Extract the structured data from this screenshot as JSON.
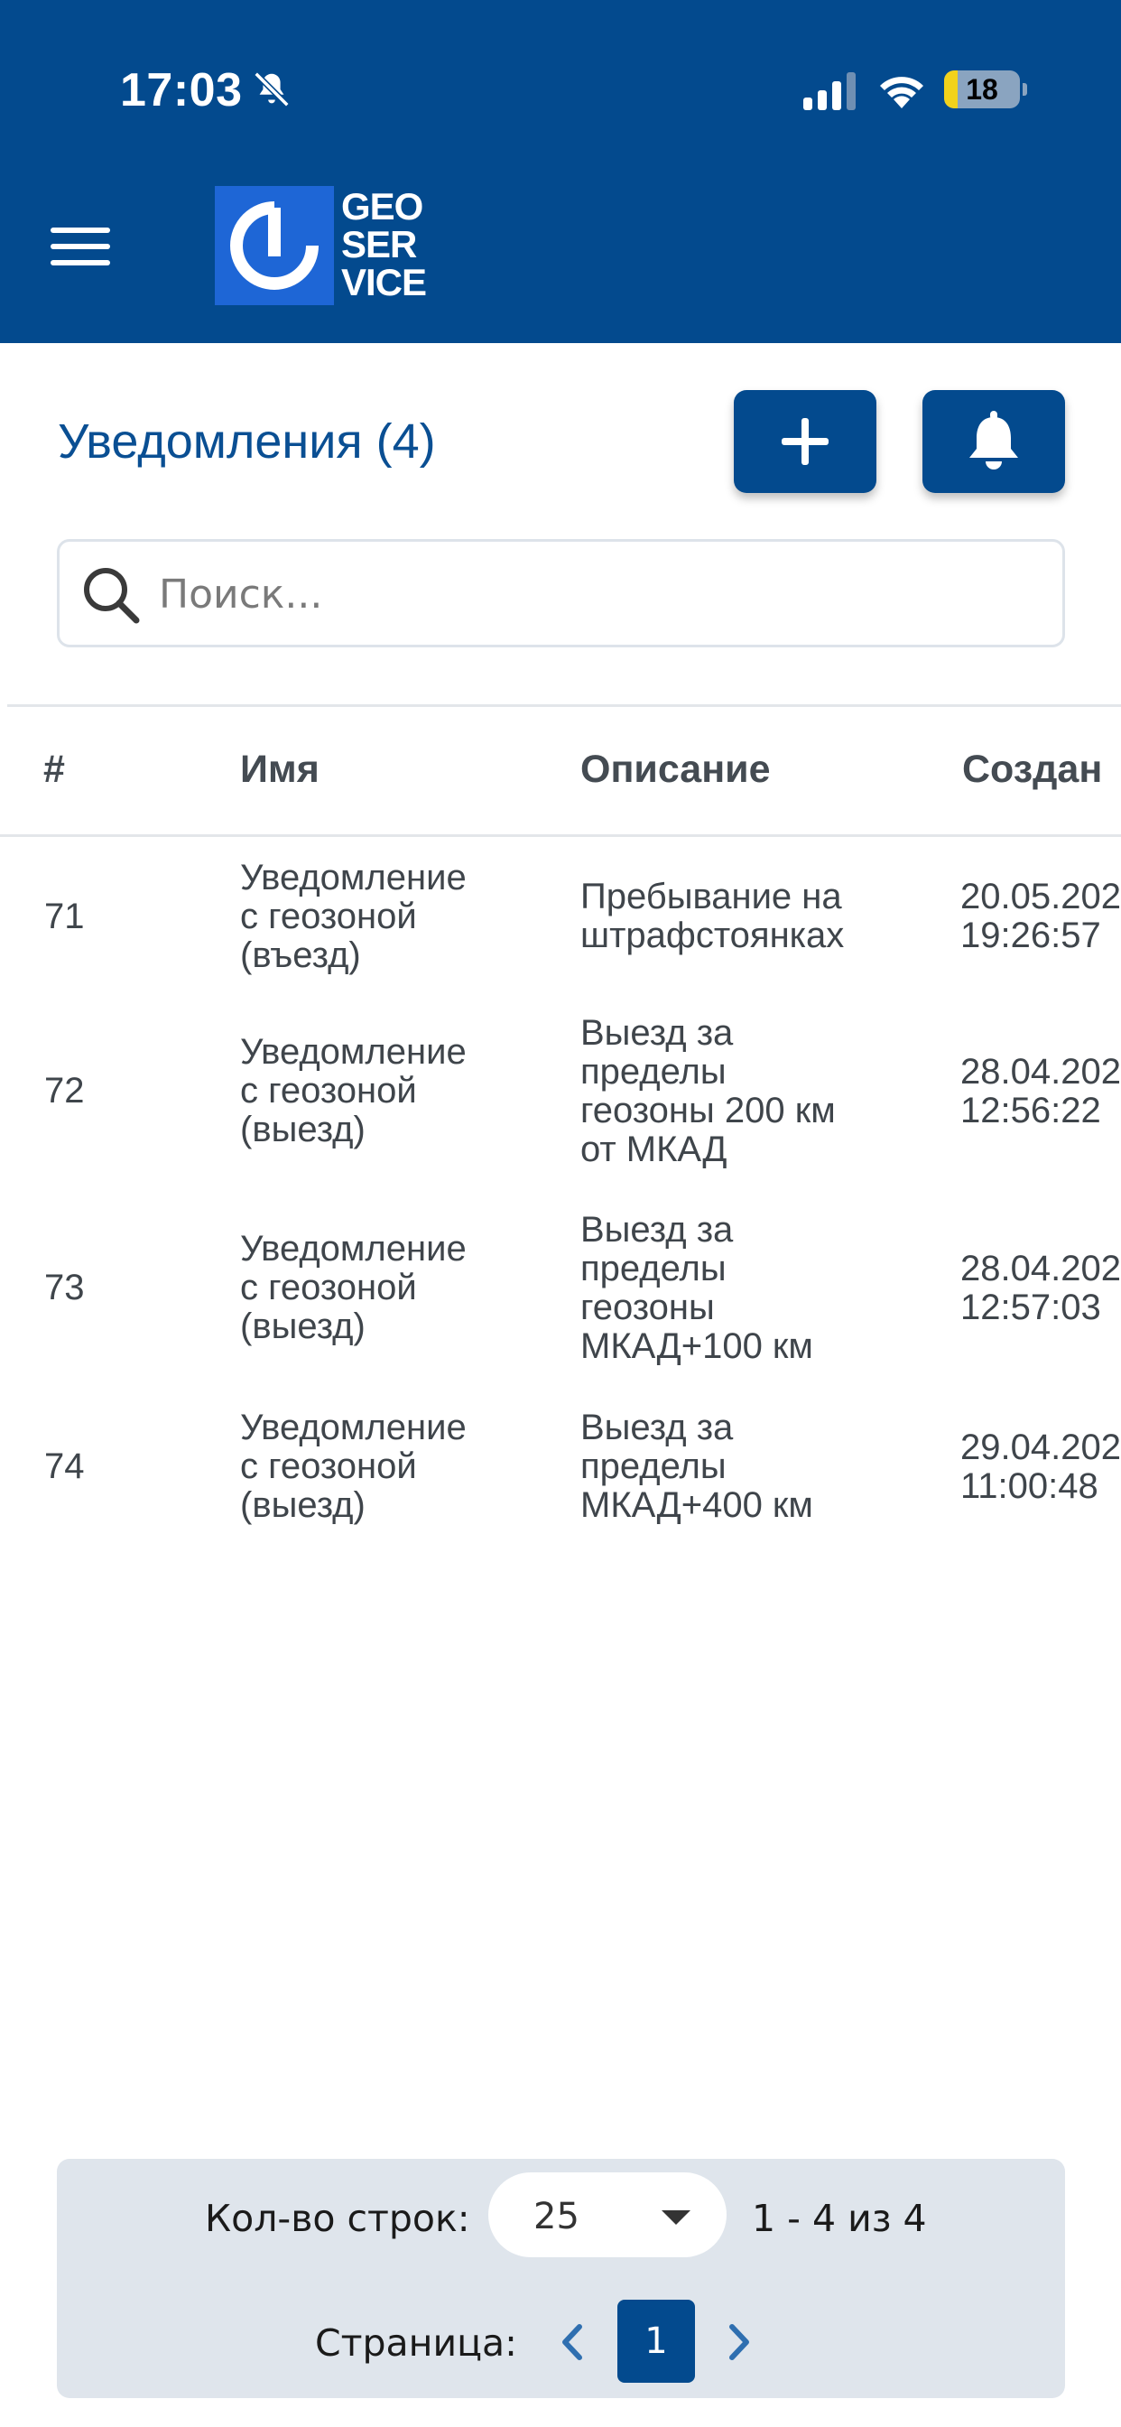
{
  "status_bar": {
    "time": "17:03",
    "battery": "18",
    "battery_level": 0.18
  },
  "app": {
    "logo_text_line1": "GEO",
    "logo_text_line2": "SER",
    "logo_text_line3": "VICE"
  },
  "header": {
    "title": "Уведомления (4)"
  },
  "search": {
    "placeholder": "Поиск..."
  },
  "table": {
    "columns": [
      "#",
      "Имя",
      "Описание",
      "Создан"
    ],
    "rows": [
      {
        "id": "71",
        "name": [
          "Уведомление",
          "с геозоной",
          "(въезд)"
        ],
        "description": [
          "Пребывание на",
          "штрафстоянках"
        ],
        "created": [
          "20.05.202",
          "19:26:57"
        ]
      },
      {
        "id": "72",
        "name": [
          "Уведомление",
          "с геозоной",
          "(выезд)"
        ],
        "description": [
          "Выезд за",
          "пределы",
          "геозоны 200 км",
          "от МКАД"
        ],
        "created": [
          "28.04.202",
          "12:56:22"
        ]
      },
      {
        "id": "73",
        "name": [
          "Уведомление",
          "с геозоной",
          "(выезд)"
        ],
        "description": [
          "Выезд за",
          "пределы",
          "геозоны",
          "МКАД+100 км"
        ],
        "created": [
          "28.04.202",
          "12:57:03"
        ]
      },
      {
        "id": "74",
        "name": [
          "Уведомление",
          "с геозоной",
          "(выезд)"
        ],
        "description": [
          "Выезд за",
          "пределы",
          "МКАД+400 км"
        ],
        "created": [
          "29.04.202",
          "11:00:48"
        ]
      }
    ]
  },
  "pagination": {
    "rows_label": "Кол-во строк:",
    "rows_value": "25",
    "range": "1 - 4 из 4",
    "page_label": "Страница:",
    "current_page": "1"
  },
  "colors": {
    "brand": "#034a8e",
    "title": "#0a4f93",
    "pager_bg": "#dfe5ec"
  },
  "icons": [
    "mute-bell-icon",
    "signal-icon",
    "wifi-icon",
    "battery-icon",
    "hamburger-icon",
    "plus-icon",
    "bell-icon",
    "search-icon",
    "chevron-down-icon",
    "chevron-left-icon",
    "chevron-right-icon"
  ]
}
